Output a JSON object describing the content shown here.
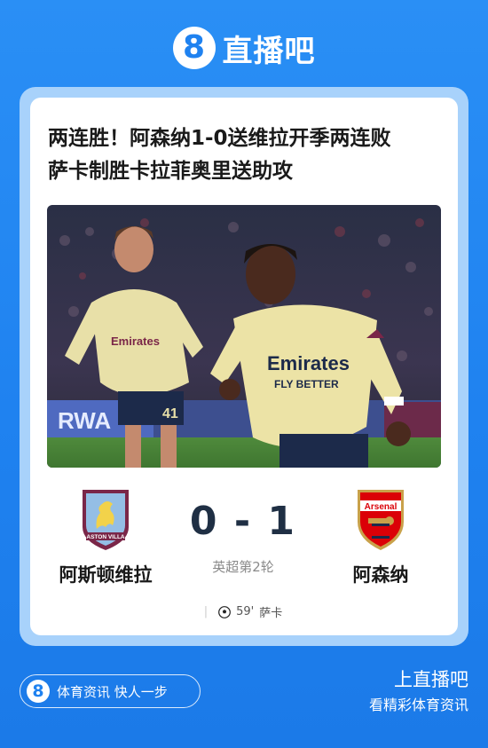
{
  "brand": {
    "logo_glyph": "8",
    "name": "直播吧"
  },
  "article": {
    "headline_line1": "两连胜！阿森纳1-0送维拉开季两连败",
    "headline_line2": "萨卡制胜卡拉菲奥里送助攻"
  },
  "match": {
    "home_team": "阿斯顿维拉",
    "away_team": "阿森纳",
    "score": "0 - 1",
    "round": "英超第2轮",
    "scorer_minute": "59'",
    "scorer_name": "萨卡",
    "home_crest_text": "ASTON VILLA",
    "away_crest_text": "Arsenal"
  },
  "footer": {
    "pill_glyph": "8",
    "pill_text": "体育资讯 快人一步",
    "cta_title": "上直播吧",
    "cta_sub": "看精彩体育资讯"
  },
  "photo": {
    "shirt_text_1": "Emirates",
    "shirt_text_2": "FLY BETTER",
    "shirt_number": "41"
  },
  "colors": {
    "background": "#1f82f0",
    "frame": "#a8d2fb",
    "card": "#ffffff",
    "score_text": "#1f2f44",
    "villa_claret": "#7a2648",
    "villa_blue": "#94bee5",
    "arsenal_red": "#db0007"
  }
}
